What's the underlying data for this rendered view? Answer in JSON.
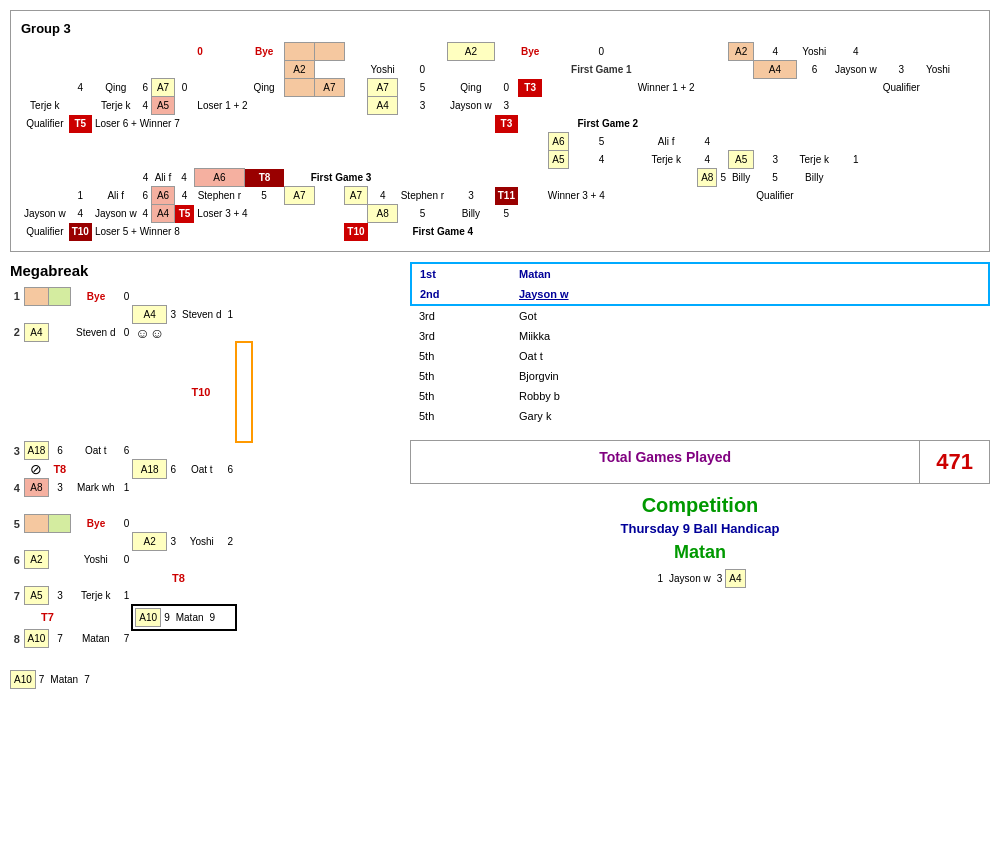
{
  "group3": {
    "title": "Group 3",
    "totalGames": {
      "label": "Total Games Played",
      "value": "471"
    },
    "competition": {
      "title": "Competition",
      "subtitle": "Thursday 9 Ball Handicap",
      "winner": "Matan"
    },
    "standings": [
      {
        "rank": "1st",
        "name": "Matan",
        "highlight": true
      },
      {
        "rank": "2nd",
        "name": "Jayson w",
        "highlight": true
      },
      {
        "rank": "3rd",
        "name": "Got",
        "highlight": false
      },
      {
        "rank": "3rd",
        "name": "Miikka",
        "highlight": false
      },
      {
        "rank": "5th",
        "name": "Oat t",
        "highlight": false
      },
      {
        "rank": "5th",
        "name": "Bjorgvin",
        "highlight": false
      },
      {
        "rank": "5th",
        "name": "Robby b",
        "highlight": false
      },
      {
        "rank": "5th",
        "name": "Gary k",
        "highlight": false
      }
    ],
    "megabreak": {
      "title": "Megabreak"
    }
  }
}
